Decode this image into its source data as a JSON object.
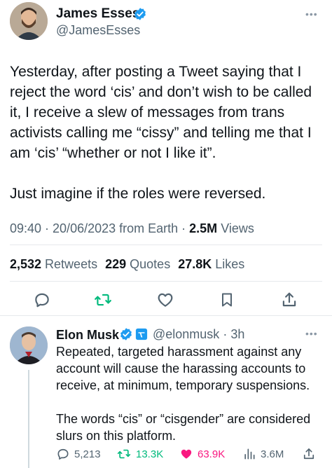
{
  "tweet": {
    "author_name": "James Esses",
    "author_handle": "@JamesEsses",
    "more_label": "•••",
    "text": "Yesterday, after posting a Tweet saying that I reject the word ‘cis’ and don’t wish to be called it, I receive a slew of messages from trans activists calling me “cissy” and telling me that I am ‘cis’ “whether or not I like it”.\n\nJust imagine if the roles were reversed.",
    "time": "09:40 · 20/06/2023 from Earth · ",
    "views_count": "2.5M",
    "views_label": " Views",
    "retweets_count": "2,532",
    "retweets_label": " Retweets",
    "quotes_count": "229",
    "quotes_label": " Quotes",
    "likes_count": "27.8K",
    "likes_label": " Likes"
  },
  "reply": {
    "author_name": "Elon Musk",
    "author_handle": "@elonmusk",
    "separator": " · ",
    "age": "3h",
    "more_label": "•••",
    "text": "Repeated, targeted harassment against any account will cause the harassing accounts to receive, at minimum, temporary suspensions.\n\nThe words “cis” or “cisgender” are considered slurs on this platform.",
    "replies": "5,213",
    "retweets": "13.3K",
    "likes": "63.9K",
    "views": "3.6M"
  },
  "colors": {
    "verified": "#1d9bf0",
    "retweet_green": "#00ba7c",
    "like_pink": "#f91880",
    "secondary_text": "#536471"
  },
  "icons": [
    "verified-badge-icon",
    "reply-icon",
    "retweet-icon",
    "like-icon",
    "bookmark-icon",
    "share-icon",
    "views-icon",
    "affiliate-badge-icon"
  ]
}
